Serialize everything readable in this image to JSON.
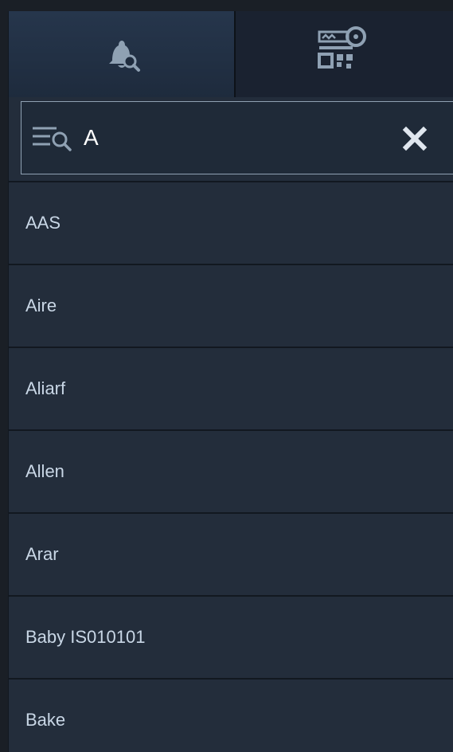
{
  "tabs": [
    {
      "icon": "bell-search-icon",
      "selected": true
    },
    {
      "icon": "key-qr-icon",
      "selected": false
    }
  ],
  "search": {
    "value": "A",
    "filter_icon": "filter-search-icon",
    "clear_icon": "close-icon"
  },
  "list": {
    "items": [
      {
        "label": "AAS"
      },
      {
        "label": "Aire"
      },
      {
        "label": "Aliarf"
      },
      {
        "label": "Allen"
      },
      {
        "label": "Arar"
      },
      {
        "label": "Baby IS010101"
      },
      {
        "label": "Bake"
      }
    ]
  },
  "colors": {
    "background": "#232d3b",
    "text": "#c9d7e6",
    "icon": "#8fa1b3"
  }
}
